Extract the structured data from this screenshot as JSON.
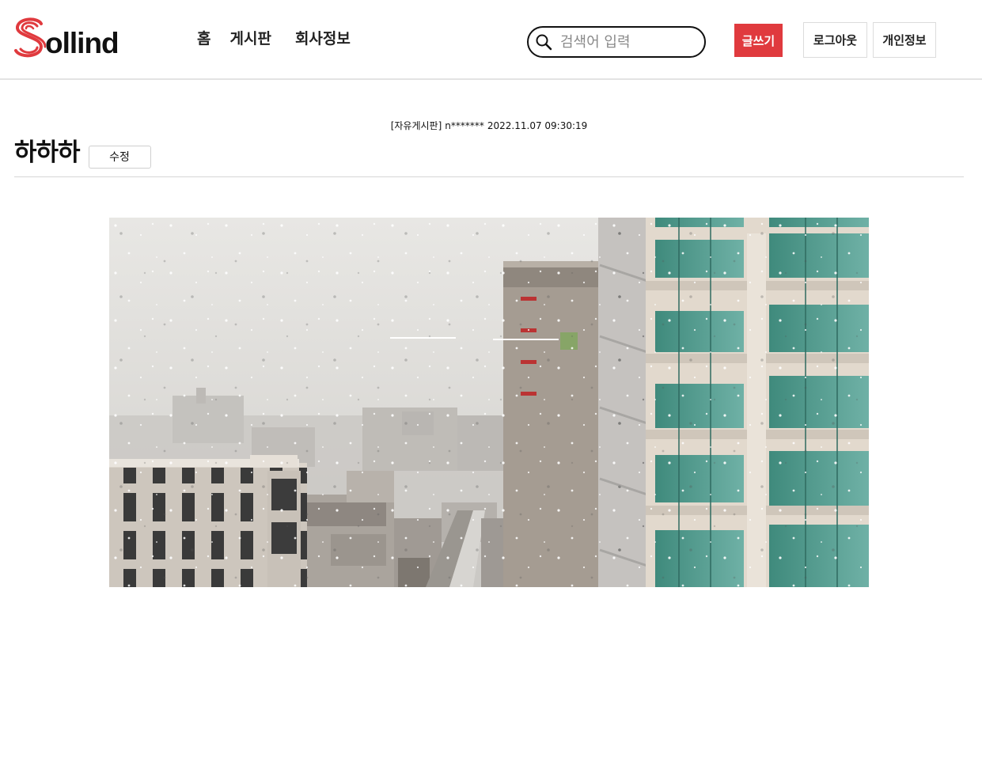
{
  "header": {
    "logo_text": "ollind",
    "nav": [
      {
        "label": "홈"
      },
      {
        "label": "게시판"
      },
      {
        "label": "회사정보"
      }
    ],
    "search": {
      "placeholder": "검색어 입력",
      "icon": "search-icon"
    },
    "write_label": "글쓰기",
    "logout_label": "로그아웃",
    "profile_label": "개인정보",
    "colors": {
      "brand": "#e03a3e",
      "border": "#e3e3e3"
    }
  },
  "post": {
    "board": "[자유게시판]",
    "author": "n*******",
    "datetime": "2022.11.07 09:30:19",
    "title": "하하하",
    "edit_label": "수정",
    "image": {
      "icon": "photo-snowy-city"
    }
  }
}
